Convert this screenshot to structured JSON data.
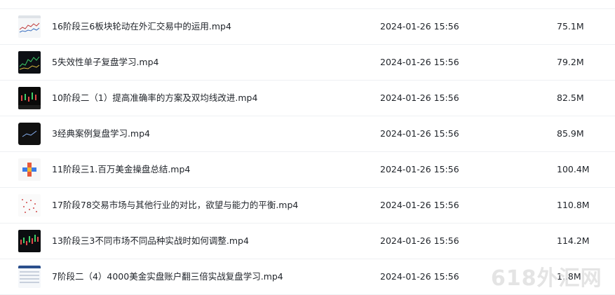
{
  "files": [
    {
      "name": "16阶段三6板块轮动在外汇交易中的运用.mp4",
      "date": "2024-01-26 15:56",
      "size": "75.1M",
      "thumb": "light-chart"
    },
    {
      "name": "5失效性单子复盘学习.mp4",
      "date": "2024-01-26 15:56",
      "size": "79.2M",
      "thumb": "dark-chart"
    },
    {
      "name": "10阶段二（1）提高准确率的方案及双均线改进.mp4",
      "date": "2024-01-26 15:56",
      "size": "82.5M",
      "thumb": "dark-chart"
    },
    {
      "name": "3经典案例复盘学习.mp4",
      "date": "2024-01-26 15:56",
      "size": "85.9M",
      "thumb": "dark-plain"
    },
    {
      "name": "11阶段三1.百万美金操盘总结.mp4",
      "date": "2024-01-26 15:56",
      "size": "100.4M",
      "thumb": "light-logo"
    },
    {
      "name": "17阶段78交易市场与其他行业的对比，欲望与能力的平衡.mp4",
      "date": "2024-01-26 15:56",
      "size": "110.8M",
      "thumb": "light-dots"
    },
    {
      "name": "13阶段三3不同市场不同品种实战时如何调整.mp4",
      "date": "2024-01-26 15:56",
      "size": "114.2M",
      "thumb": "dark-chart"
    },
    {
      "name": "7阶段二（4）4000美金实盘账户翻三倍实战复盘学习.mp4",
      "date": "2024-01-26 15:56",
      "size": "1..8M",
      "thumb": "light-table"
    }
  ],
  "watermark": "618外汇网"
}
